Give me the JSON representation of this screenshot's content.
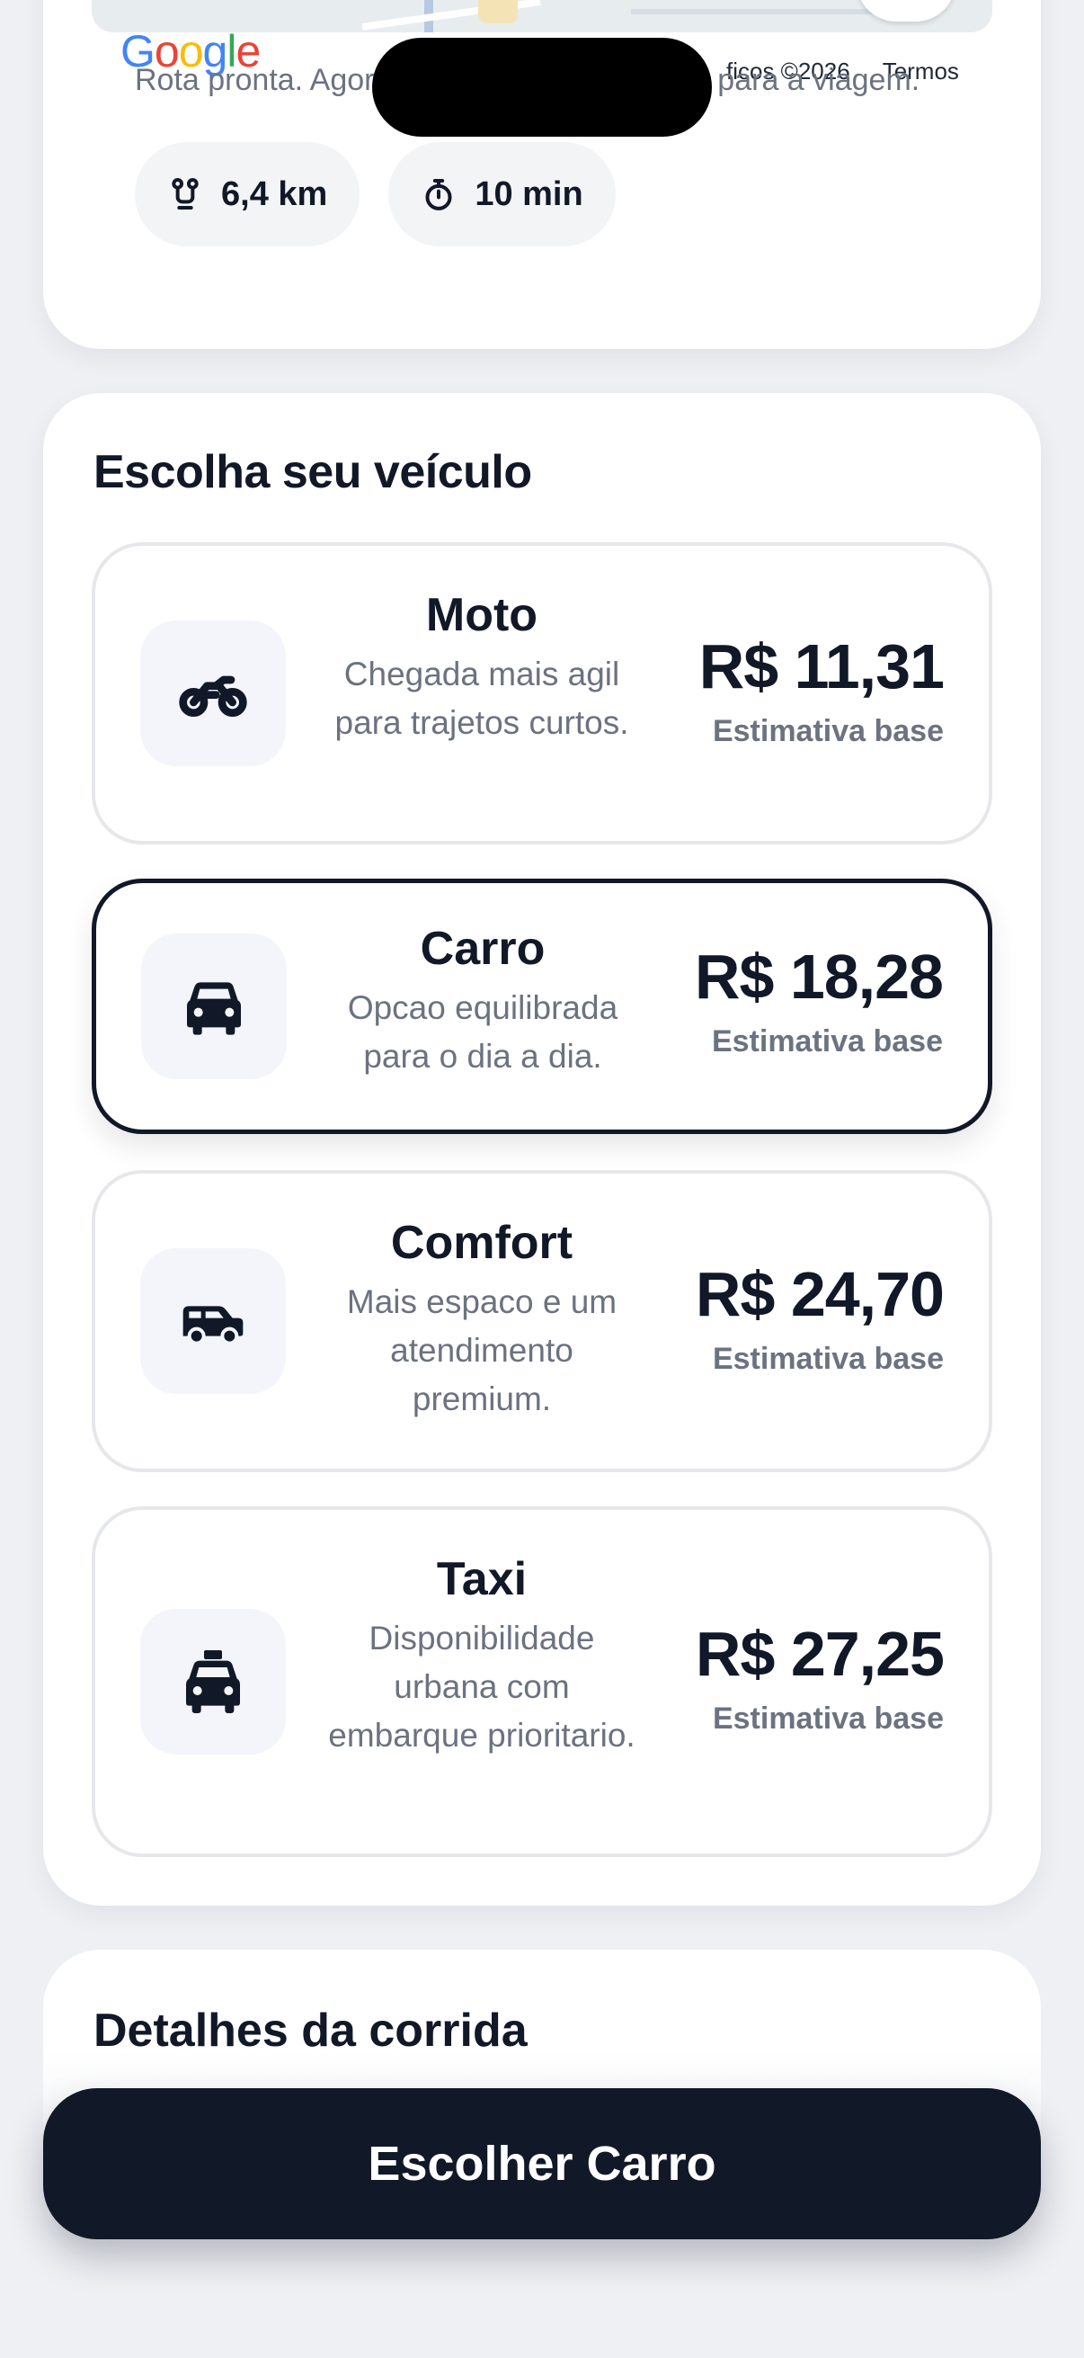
{
  "map": {
    "logo_letters": [
      "G",
      "o",
      "o",
      "g",
      "l",
      "e"
    ],
    "attribution": "ficos ©2026",
    "terms": "Termos"
  },
  "route": {
    "status": "Rota pronta. Agora escolha o veículo ideal para a viagem.",
    "distance": "6,4 km",
    "duration": "10 min"
  },
  "vehicles": {
    "title": "Escolha seu veículo",
    "options": [
      {
        "name": "Moto",
        "description": "Chegada mais agil para trajetos curtos.",
        "price": "R$ 11,31",
        "price_note": "Estimativa base",
        "icon": "motorcycle-icon",
        "selected": false
      },
      {
        "name": "Carro",
        "description": "Opcao equilibrada para o dia a dia.",
        "price": "R$ 18,28",
        "price_note": "Estimativa base",
        "icon": "car-icon",
        "selected": true
      },
      {
        "name": "Comfort",
        "description": "Mais espaco e um atendimento premium.",
        "price": "R$ 24,70",
        "price_note": "Estimativa base",
        "icon": "suv-icon",
        "selected": false
      },
      {
        "name": "Taxi",
        "description": "Disponibilidade urbana com embarque prioritario.",
        "price": "R$ 27,25",
        "price_note": "Estimativa base",
        "icon": "taxi-icon",
        "selected": false
      }
    ]
  },
  "details": {
    "title": "Detalhes da corrida"
  },
  "cta": {
    "label": "Escolher Carro"
  },
  "colors": {
    "primary": "#111827",
    "muted": "#6b7280",
    "background": "#eef0f4",
    "icon_bg": "#f3f5fa"
  }
}
